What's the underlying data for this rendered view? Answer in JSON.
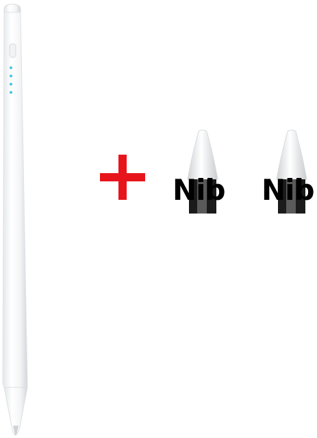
{
  "product": {
    "items": [
      {
        "icon": "stylus-pen-icon"
      },
      {
        "icon": "plus-icon",
        "color": "#e8141b"
      },
      {
        "icon": "pen-nib-icon",
        "label": "Nib"
      },
      {
        "icon": "pen-nib-icon",
        "label": "Nib"
      }
    ],
    "indicator_color": "#3ec8e6"
  }
}
